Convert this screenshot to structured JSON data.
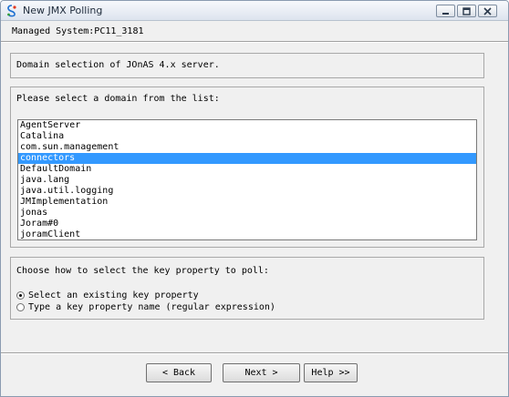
{
  "window": {
    "title": "New JMX Polling",
    "icon": "app-icon",
    "controls": [
      "minimize-icon",
      "maximize-icon",
      "close-icon"
    ]
  },
  "header": {
    "managed_system": "Managed System:PC11_3181"
  },
  "description": {
    "text": "Domain selection of JOnAS 4.x server."
  },
  "domain_list": {
    "prompt": "Please select a domain from the list:",
    "selected": "connectors",
    "items": [
      "AgentServer",
      "Catalina",
      "com.sun.management",
      "connectors",
      "DefaultDomain",
      "java.lang",
      "java.util.logging",
      "JMImplementation",
      "jonas",
      "Joram#0",
      "joramClient"
    ]
  },
  "key_property": {
    "prompt": "Choose how to select the key property to poll:",
    "options": [
      {
        "label": "Select an existing key property",
        "checked": true
      },
      {
        "label": "Type a key property name (regular expression)",
        "checked": false
      }
    ]
  },
  "buttons": {
    "back": "< Back",
    "next": "Next >",
    "help": "Help >>"
  },
  "colors": {
    "selection": "#3399ff",
    "background": "#f0f0f0"
  }
}
